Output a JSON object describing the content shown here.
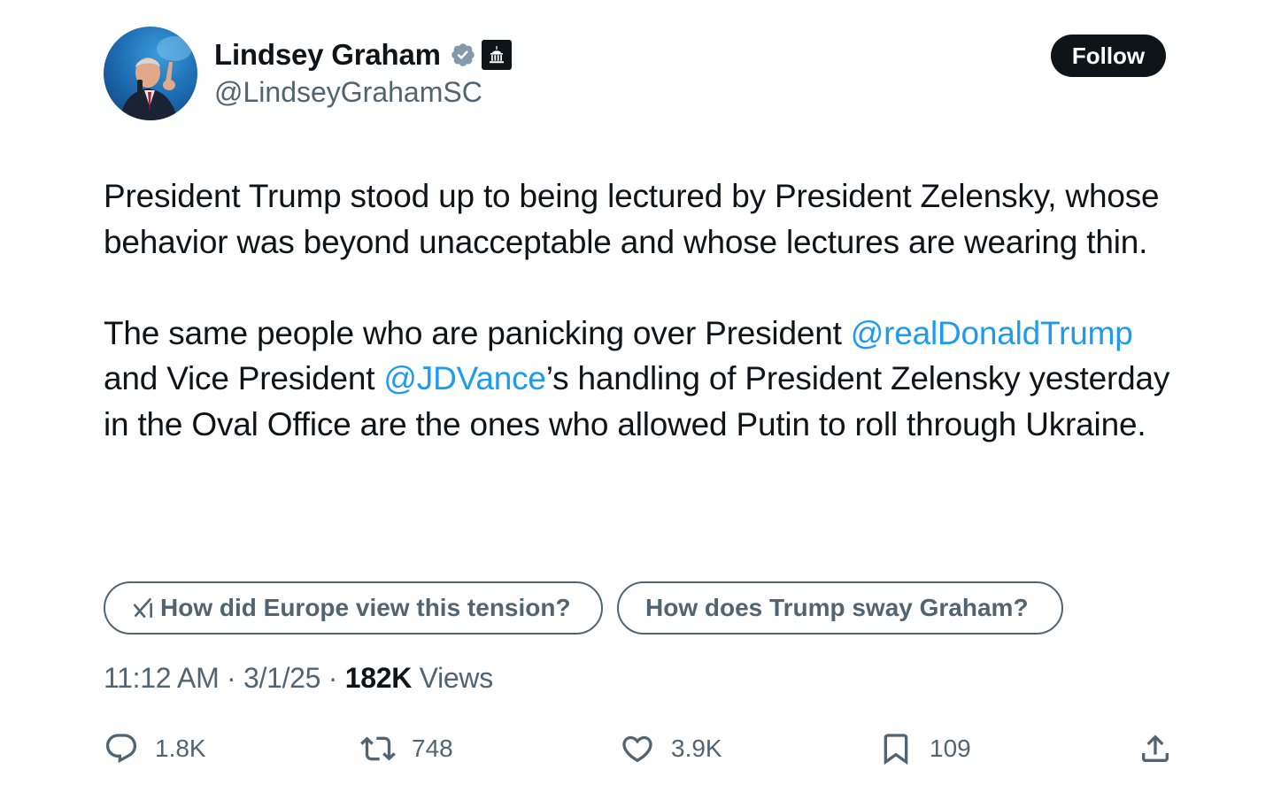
{
  "author": {
    "name": "Lindsey Graham",
    "handle": "@LindseyGrahamSC",
    "verified_icon": "verified-badge-icon",
    "gov_icon": "government-building-badge-icon"
  },
  "follow_label": "Follow",
  "tweet": {
    "paragraph1": "President Trump stood up to being lectured by President Zelensky, whose behavior was beyond unacceptable and whose lectures are wearing thin.",
    "p2_part1": "The same people who are panicking over President ",
    "p2_mention1": "@realDonaldTrump",
    "p2_part2": " and Vice President ",
    "p2_mention2": "@JDVance",
    "p2_part3": "’s handling of President Zelensky yesterday in the Oval Office are the ones who allowed Putin to roll through Ukraine."
  },
  "suggestions": [
    {
      "label": "How did Europe view this tension?",
      "icon": "grok-icon"
    },
    {
      "label": "How does Trump sway Graham?"
    }
  ],
  "meta": {
    "time": "11:12 AM",
    "sep1": " · ",
    "date": "3/1/25",
    "sep2": " · ",
    "views_count": "182K",
    "views_label": " Views"
  },
  "actions": {
    "replies": "1.8K",
    "reposts": "748",
    "likes": "3.9K",
    "bookmarks": "109"
  },
  "colors": {
    "text": "#0f1419",
    "secondary": "#536471",
    "link": "#1d9bf0",
    "verified": "#829aab"
  }
}
